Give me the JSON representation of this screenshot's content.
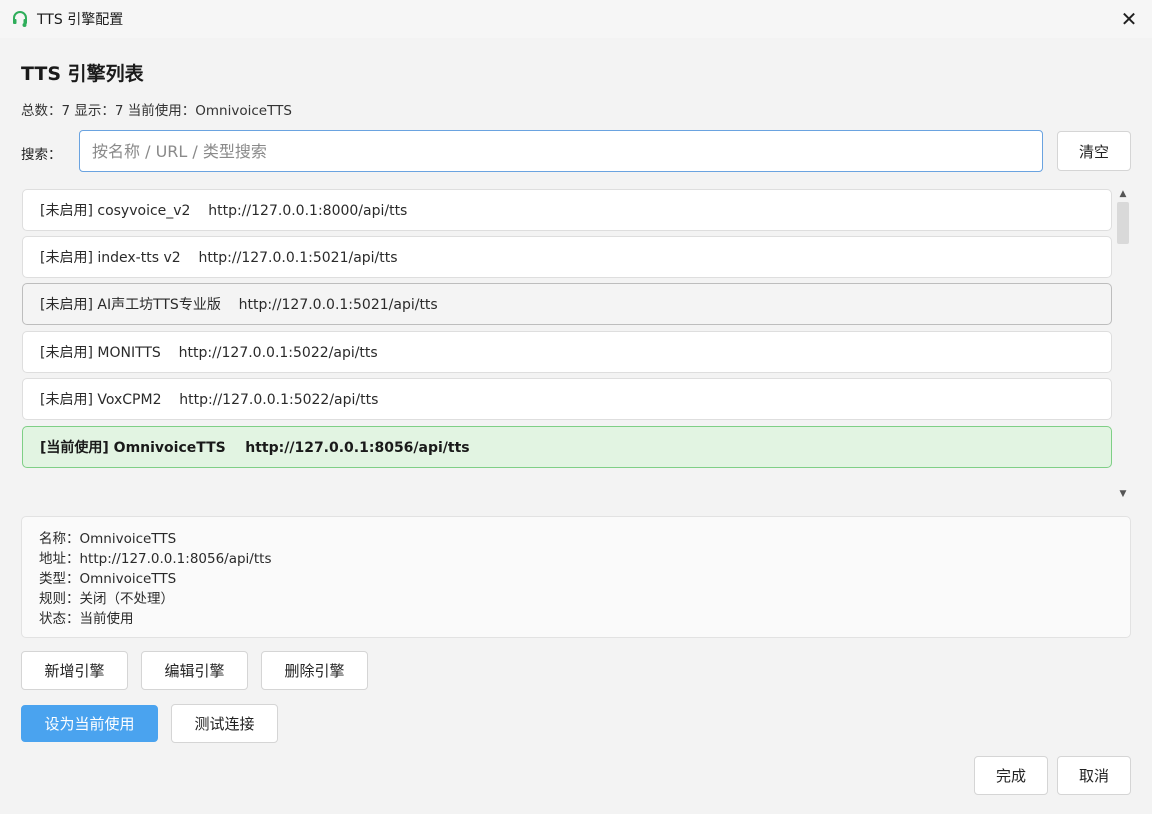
{
  "window": {
    "title": "TTS 引擎配置"
  },
  "heading": "TTS 引擎列表",
  "summary": "总数：7  显示：7  当前使用：OmnivoiceTTS",
  "search": {
    "label": "搜索：",
    "placeholder": "按名称 / URL / 类型搜索",
    "value": "",
    "clear_label": "清空"
  },
  "engines": [
    {
      "label": "[未启用] cosyvoice_v2    http://127.0.0.1:8000/api/tts",
      "state": "normal"
    },
    {
      "label": "[未启用] index-tts v2    http://127.0.0.1:5021/api/tts",
      "state": "normal"
    },
    {
      "label": "[未启用] AI声工坊TTS专业版    http://127.0.0.1:5021/api/tts",
      "state": "hover"
    },
    {
      "label": "[未启用] MONITTS    http://127.0.0.1:5022/api/tts",
      "state": "normal"
    },
    {
      "label": "[未启用] VoxCPM2    http://127.0.0.1:5022/api/tts",
      "state": "normal"
    },
    {
      "label": "[当前使用] OmnivoiceTTS    http://127.0.0.1:8056/api/tts",
      "state": "active"
    }
  ],
  "details": {
    "name": "名称：OmnivoiceTTS",
    "url": "地址：http://127.0.0.1:8056/api/tts",
    "type": "类型：OmnivoiceTTS",
    "rule": "规则：关闭（不处理）",
    "status": "状态：当前使用"
  },
  "actions": {
    "add": "新增引擎",
    "edit": "编辑引擎",
    "delete": "删除引擎",
    "set_current": "设为当前使用",
    "test": "测试连接",
    "done": "完成",
    "cancel": "取消"
  },
  "colors": {
    "primary": "#4aa3ef",
    "active_bg": "#e2f4e2",
    "active_border": "#7fcf86",
    "focus_border": "#6aa3e0"
  },
  "icons": {
    "app": "headset-icon",
    "close": "close-icon"
  }
}
